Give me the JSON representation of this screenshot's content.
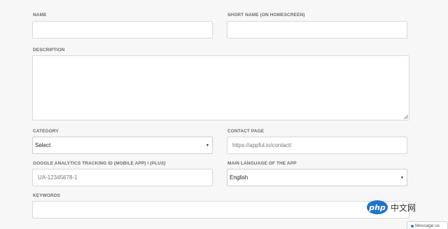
{
  "form": {
    "name_label": "NAME",
    "name_value": "",
    "short_name_label": "SHORT NAME (ON HOMESCREEN)",
    "short_name_value": "",
    "description_label": "DESCRIPTION",
    "description_value": "",
    "category_label": "CATEGORY",
    "category_selected": "Select",
    "contact_label": "CONTACT PAGE",
    "contact_placeholder": "https://appful.io/contact/",
    "ga_label": "GOOGLE ANALYTICS TRACKING ID (MOBILE APP) / ",
    "ga_label_plan": "(PLUS)",
    "ga_placeholder": "UA-12345678-1",
    "language_label": "MAIN LANGUAGE OF THE APP",
    "language_selected": "English",
    "keywords_label": "KEYWORDS",
    "keywords_value": ""
  },
  "watermark": {
    "logo": "php",
    "text": "中文网"
  },
  "chat": {
    "label": "Message us"
  },
  "icons": {
    "dropdown": "triangle-down-icon",
    "resize": "resize-grip-icon",
    "chat": "chat-dot-icon"
  }
}
